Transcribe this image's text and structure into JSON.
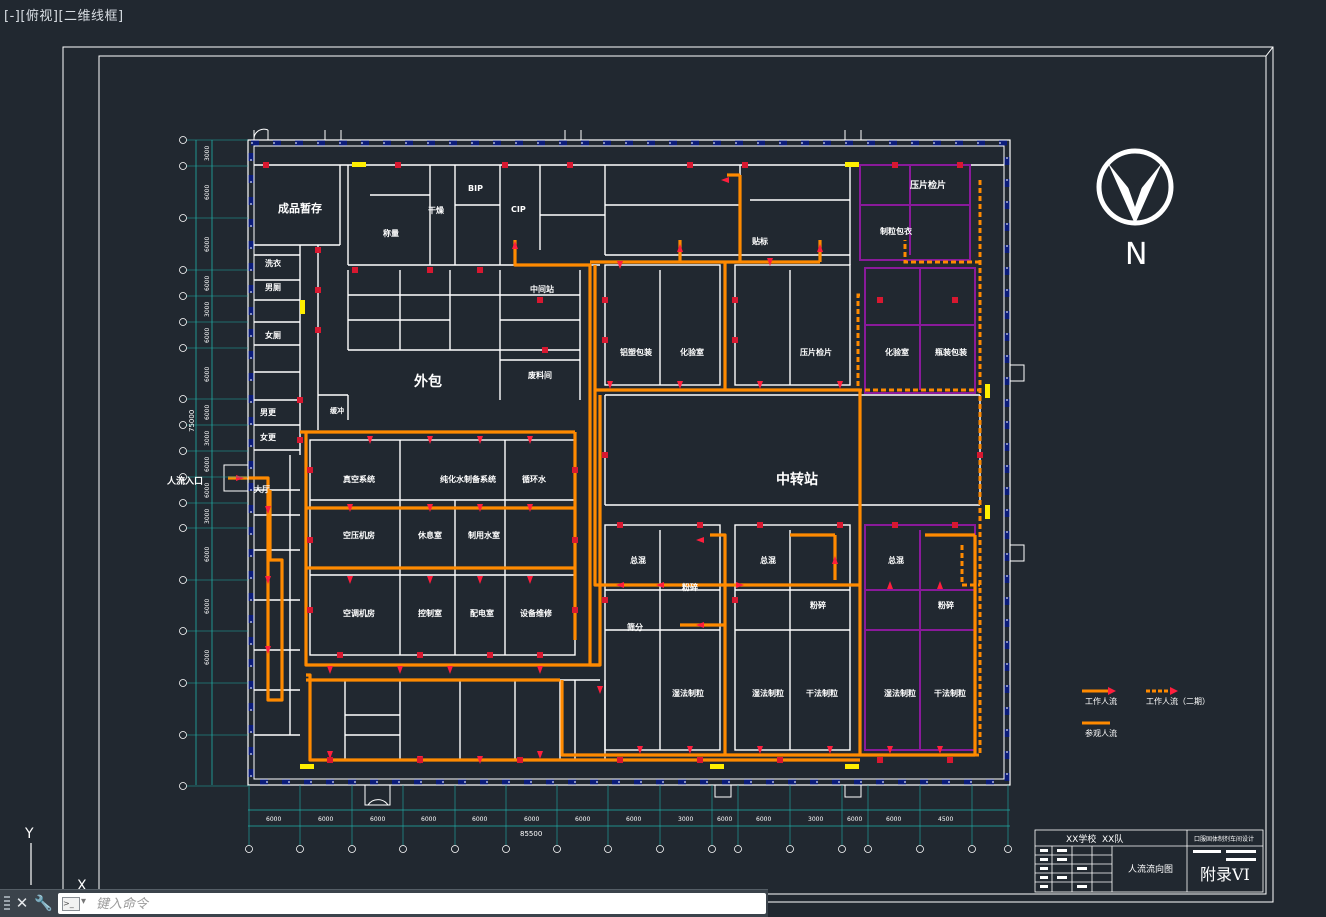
{
  "viewport": {
    "label": "[-][俯视][二维线框]"
  },
  "compass": {
    "north_label": "N"
  },
  "title_block": {
    "school": "XX学校",
    "team": "XX队",
    "design": "口服固体制剂车间设计",
    "drawing_name": "人流流向图",
    "appendix": "附录VI"
  },
  "rooms": {
    "finished_storage": "成品暂存",
    "outer_pack": "外包",
    "transfer_station": "中转站",
    "entrance": "人流入口",
    "hall": "大厅",
    "tablet_press_top": "压片检片",
    "cip": "CIP",
    "bip": "BIP",
    "dry": "干燥",
    "coat_prep": "制粒包衣",
    "purified_water": "纯化水制备系统",
    "vacuum": "真空系统",
    "circulating_water": "循环水",
    "air_compressor": "空压机房",
    "rest": "休息室",
    "drink_water": "制用水室",
    "cooling": "空调机房",
    "control": "控制室",
    "distribution": "配电室",
    "equipment": "设备维修",
    "mixed": "总混",
    "granulate": "粉碎",
    "dry_granulate": "湿法制粒",
    "dry_pack": "干法制粒",
    "washing": "洗衣",
    "toilet_m": "男厕",
    "toilet_f": "女厕",
    "dressing_m": "男更",
    "dressing_f": "女更",
    "buffer": "缓冲",
    "weigh": "称量",
    "sieve": "筛分",
    "mid_station": "中间站",
    "aluminum": "铝塑包装",
    "bottling": "瓶装包装",
    "labeling": "贴标",
    "waste": "废料间",
    "lab": "化验室",
    "press_inspect": "压片检片"
  },
  "dimensions": {
    "bottom": [
      "6000",
      "6000",
      "6000",
      "6000",
      "6000",
      "6000",
      "6000",
      "6000",
      "3000",
      "6000",
      "6000",
      "3000",
      "6000",
      "6000",
      "4500"
    ],
    "total": "85500",
    "left": [
      "3000",
      "6000",
      "6000",
      "6000",
      "3000",
      "6000",
      "6000",
      "6000",
      "3000",
      "6000",
      "6000",
      "3000",
      "6000",
      "6000",
      "6000"
    ],
    "left_total": "75000"
  },
  "legend": {
    "worker": "工作人流",
    "worker_second": "工作人流（二期）",
    "visitor": "参观人流"
  },
  "axes": {
    "y_label": "Y",
    "x_label": "X"
  },
  "command": {
    "placeholder": "键入命令"
  },
  "colors": {
    "background": "#212830",
    "walls": "#ffffff",
    "columns": "#0a1a6e",
    "worker_flow": "#ff8a00",
    "arrow": "#ff1f3d",
    "purple_zone": "#8a1a9a",
    "dimension": "#20b0a8",
    "door": "#ff2030",
    "highlight": "#ffee00"
  }
}
